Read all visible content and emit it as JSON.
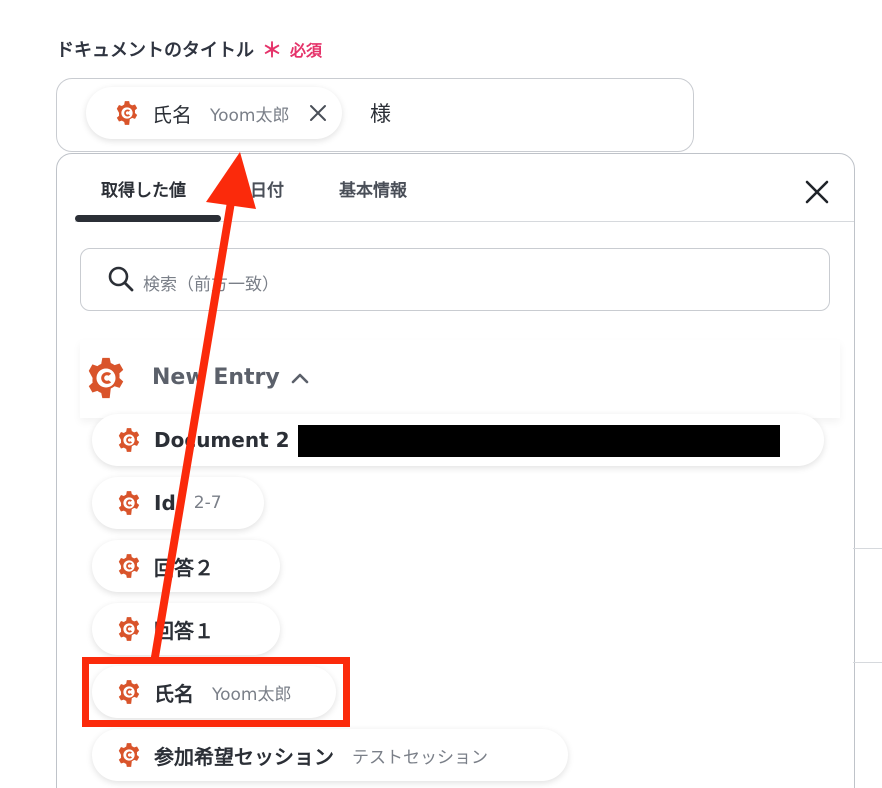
{
  "field": {
    "label": "ドキュメントのタイトル",
    "required_mark": "＊",
    "required_text": "必須"
  },
  "title_input": {
    "chip_name": "氏名",
    "chip_value": "Yoom太郎",
    "suffix": "様"
  },
  "tabs": [
    {
      "label": "取得した値",
      "active": true
    },
    {
      "label": "日付",
      "active": false
    },
    {
      "label": "基本情報",
      "active": false
    }
  ],
  "search": {
    "placeholder": "検索（前方一致）"
  },
  "group": {
    "title": "New Entry",
    "expanded": true
  },
  "items": [
    {
      "name": "Document 2",
      "value": ""
    },
    {
      "name": "Id",
      "value": "2-7"
    },
    {
      "name": "回答２",
      "value": ""
    },
    {
      "name": "回答１",
      "value": ""
    },
    {
      "name": "氏名",
      "value": "Yoom太郎"
    },
    {
      "name": "参加希望セッション",
      "value": "テストセッション"
    }
  ],
  "colors": {
    "brand_orange": "#d9542b",
    "required_pink": "#e5336a",
    "annotation_red": "#fb2a0b"
  }
}
